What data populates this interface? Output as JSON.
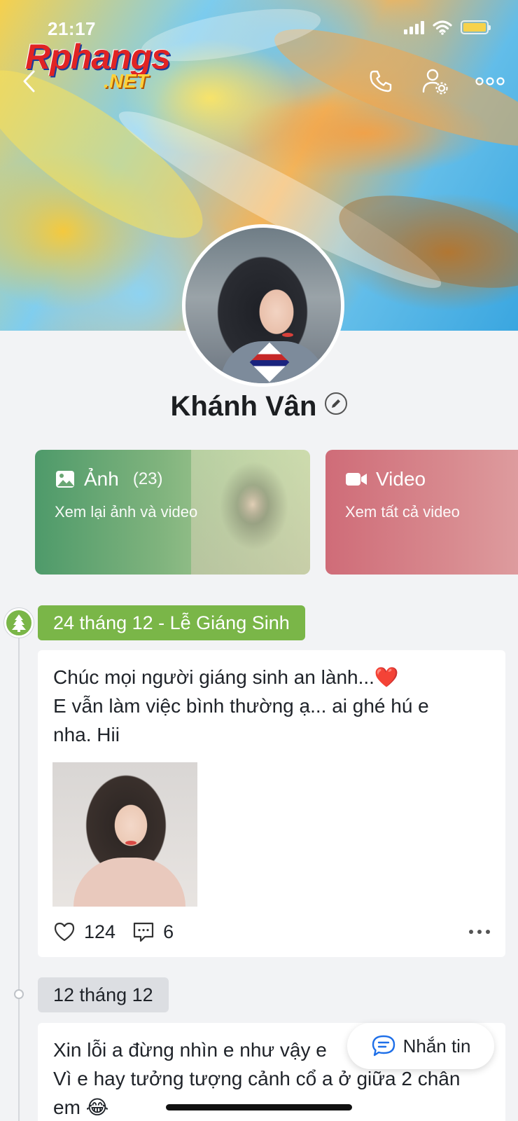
{
  "status_bar": {
    "time": "21:17"
  },
  "watermark": {
    "main": "Rphangs",
    "sub": ".NET"
  },
  "nav": {
    "back_icon": "chevron-left-icon",
    "call_icon": "phone-icon",
    "settings_icon": "user-settings-icon",
    "more_icon": "more-horizontal-icon"
  },
  "profile": {
    "name": "Khánh Vân",
    "edit_icon": "pencil-icon"
  },
  "cards": {
    "photos": {
      "title": "Ảnh",
      "count": "(23)",
      "subtitle": "Xem lại ảnh và video",
      "icon": "image-icon"
    },
    "video": {
      "title": "Video",
      "subtitle": "Xem tất cả video",
      "icon": "video-camera-icon"
    }
  },
  "timeline": [
    {
      "date": "24 tháng 12 - Lễ Giáng Sinh",
      "icon": "christmas-tree-icon",
      "text": "Chúc mọi người giáng sinh an lành...❤️\nE vẫn làm việc bình thường ạ... ai ghé hú e\nnha. Hii",
      "likes": "124",
      "comments": "6"
    },
    {
      "date": "12 tháng 12",
      "text": "Xin lỗi a đừng nhìn e như vậy e\nVì e hay tưởng tượng cảnh cổ a ở giữa 2 chân\nem 😂"
    }
  ],
  "message_button": {
    "label": "Nhắn tin",
    "icon": "chat-bubble-icon"
  },
  "colors": {
    "accent_green": "#7ab648",
    "video_card": "#cf6c78",
    "photo_card": "#4e9a6a"
  }
}
